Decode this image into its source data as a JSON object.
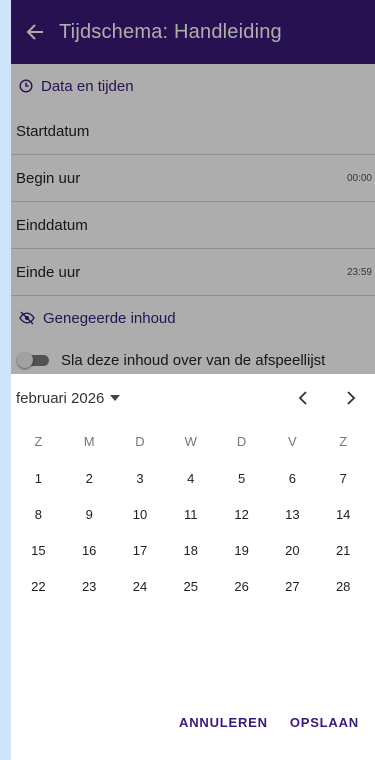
{
  "appbar": {
    "title": "Tijdschema: Handleiding"
  },
  "dates_section": {
    "title": "Data en tijden"
  },
  "rows": [
    {
      "label": "Startdatum",
      "value": ""
    },
    {
      "label": "Begin uur",
      "value": "00:00"
    },
    {
      "label": "Einddatum",
      "value": ""
    },
    {
      "label": "Einde uur",
      "value": "23:59"
    }
  ],
  "ignored_section": {
    "title": "Genegeerde inhoud"
  },
  "skip_toggle": {
    "label": "Sla deze inhoud over van de afspeellijst",
    "on": false
  },
  "picker": {
    "month_label": "februari 2026",
    "weekdays": [
      "Z",
      "M",
      "D",
      "W",
      "D",
      "V",
      "Z"
    ],
    "weeks": [
      [
        "1",
        "2",
        "3",
        "4",
        "5",
        "6",
        "7"
      ],
      [
        "8",
        "9",
        "10",
        "11",
        "12",
        "13",
        "14"
      ],
      [
        "15",
        "16",
        "17",
        "18",
        "19",
        "20",
        "21"
      ],
      [
        "22",
        "23",
        "24",
        "25",
        "26",
        "27",
        "28"
      ]
    ],
    "cancel_label": "ANNULEREN",
    "save_label": "OPSLAAN"
  },
  "colors": {
    "primary": "#3a1a78",
    "page_bg": "#cfe3fb"
  },
  "icons": [
    "back-arrow-icon",
    "clock-icon",
    "eye-off-icon",
    "caret-down-icon",
    "chevron-left-icon",
    "chevron-right-icon"
  ]
}
